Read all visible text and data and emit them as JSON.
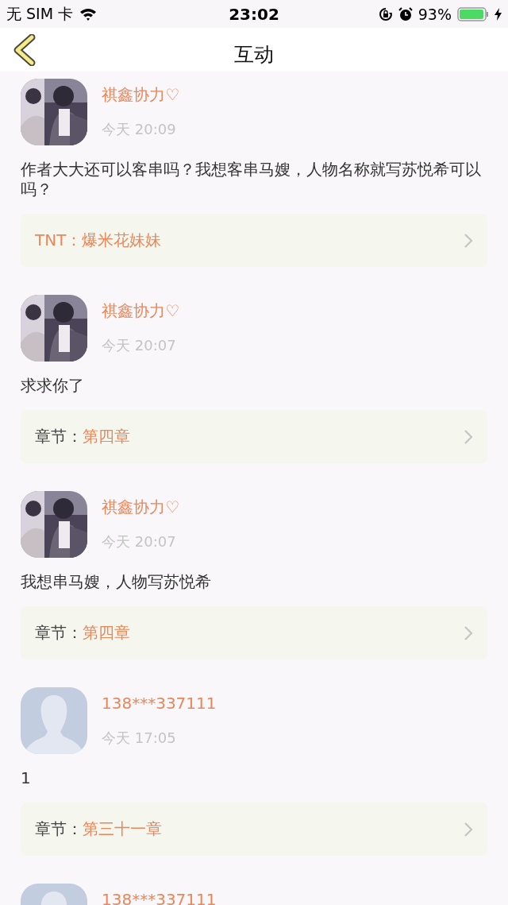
{
  "status_bar": {
    "carrier": "无 SIM 卡",
    "time": "23:02",
    "battery": "93%"
  },
  "nav": {
    "title": "互动"
  },
  "comments": [
    {
      "user": "祺鑫协力♡",
      "time": "今天 20:09",
      "text": "作者大大还可以客串吗？我想客串马嫂，人物名称就写苏悦希可以吗？",
      "link": {
        "kind": "tag",
        "label": "TNT：",
        "value": "爆米花妹妹"
      }
    },
    {
      "user": "祺鑫协力♡",
      "time": "今天 20:07",
      "text": "求求你了",
      "link": {
        "kind": "chapter",
        "label": "章节：",
        "value": "第四章"
      }
    },
    {
      "user": "祺鑫协力♡",
      "time": "今天 20:07",
      "text": "我想串马嫂，人物写苏悦希",
      "link": {
        "kind": "chapter",
        "label": "章节：",
        "value": "第四章"
      }
    },
    {
      "user": "138***337111",
      "avatar": {
        "kind": "default"
      },
      "time": "今天 17:05",
      "text": "1",
      "link": {
        "kind": "chapter",
        "label": "章节：",
        "value": "第三十一章"
      }
    },
    {
      "user": "138***337111",
      "avatar": {
        "kind": "default"
      }
    }
  ]
}
